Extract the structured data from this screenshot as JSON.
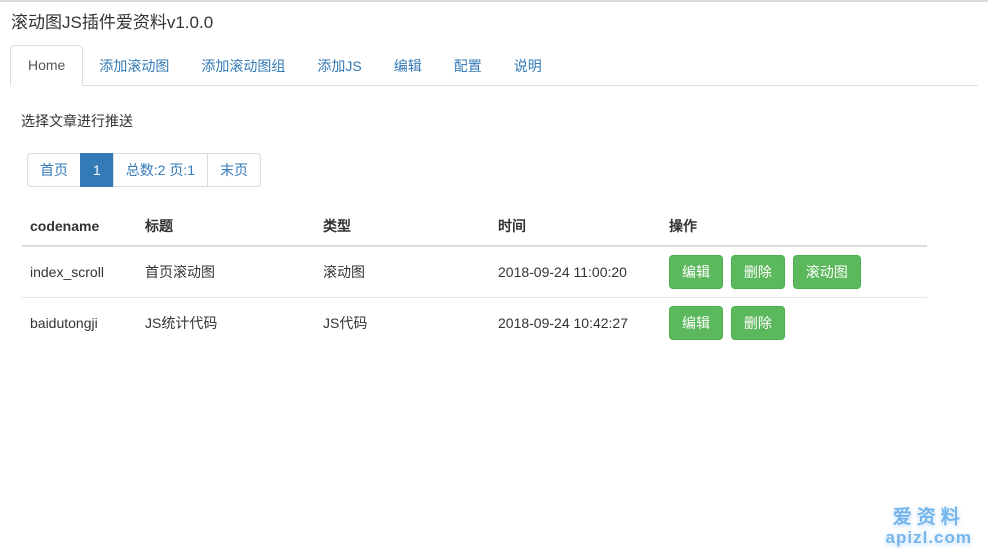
{
  "page": {
    "title": "滚动图JS插件爱资料v1.0.0"
  },
  "tabs": {
    "items": [
      {
        "label": "Home",
        "active": true
      },
      {
        "label": "添加滚动图",
        "active": false
      },
      {
        "label": "添加滚动图组",
        "active": false
      },
      {
        "label": "添加JS",
        "active": false
      },
      {
        "label": "编辑",
        "active": false
      },
      {
        "label": "配置",
        "active": false
      },
      {
        "label": "说明",
        "active": false
      }
    ]
  },
  "content": {
    "prompt": "选择文章进行推送"
  },
  "pagination": {
    "items": [
      {
        "label": "首页",
        "active": false
      },
      {
        "label": "1",
        "active": true
      },
      {
        "label": "总数:2 页:1",
        "active": false
      },
      {
        "label": "末页",
        "active": false
      }
    ]
  },
  "table": {
    "columns": [
      "codename",
      "标题",
      "类型",
      "时间",
      "操作"
    ],
    "rows": [
      {
        "codename": "index_scroll",
        "title": "首页滚动图",
        "type": "滚动图",
        "time": "2018-09-24 11:00:20",
        "actions": [
          "编辑",
          "删除",
          "滚动图"
        ]
      },
      {
        "codename": "baidutongji",
        "title": "JS统计代码",
        "type": "JS代码",
        "time": "2018-09-24 10:42:27",
        "actions": [
          "编辑",
          "删除"
        ]
      }
    ]
  },
  "watermark": {
    "line1": "爱资料",
    "line2": "apizl.com"
  },
  "colors": {
    "link": "#337ab7",
    "pagination_active_bg": "#337ab7",
    "button_bg": "#5cb85c",
    "button_border": "#4cae4c",
    "tab_active_text": "#555555",
    "border": "#dddddd"
  }
}
